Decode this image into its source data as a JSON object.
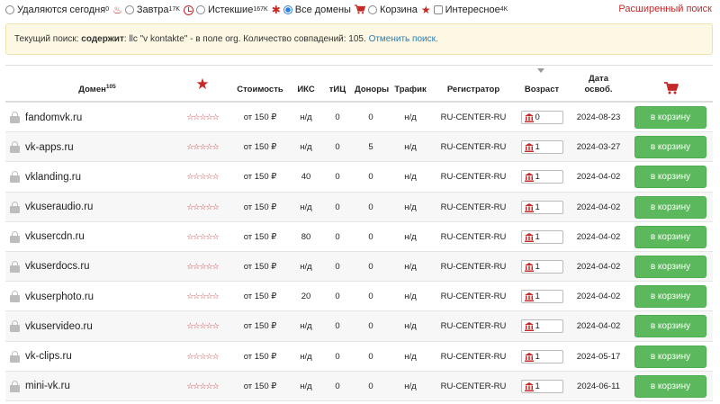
{
  "filters": [
    {
      "type": "radio",
      "checked": false,
      "icon": "",
      "label": "Удаляются сегодня",
      "sup": "0"
    },
    {
      "type": "radio",
      "checked": false,
      "icon": "fire-icon",
      "label": "Завтра",
      "sup": "17K"
    },
    {
      "type": "radio",
      "checked": false,
      "icon": "clock-icon",
      "label": "Истекшие",
      "sup": "167K"
    },
    {
      "type": "radio",
      "checked": true,
      "icon": "asterisk-icon",
      "label": "Все домены",
      "sup": ""
    },
    {
      "type": "radio",
      "checked": false,
      "icon": "cart-icon",
      "label": "Корзина",
      "sup": ""
    },
    {
      "type": "check",
      "checked": false,
      "icon": "star-icon",
      "label": "Интересное",
      "sup": "4K"
    }
  ],
  "advanced_search": "Расширенный поиск",
  "banner": {
    "prefix": "Текущий поиск: ",
    "bold": "содержит",
    "text": ": llc \"v kontakte\" - в поле org. Количество совпадений: 105. ",
    "cancel_link": "Отменить поиск."
  },
  "table": {
    "headers": {
      "domain": "Домен",
      "domain_count": "105",
      "cost": "Стоимость",
      "iks": "ИКС",
      "tic": "тИЦ",
      "donors": "Доноры",
      "traffic": "Трафик",
      "registrar": "Регистратор",
      "age": "Возраст",
      "date_line1": "Дата",
      "date_line2": "освоб."
    },
    "rating_stars": "☆☆☆☆☆",
    "button_label": "в корзину",
    "rows": [
      {
        "domain": "fandomvk.ru",
        "cost": "от 150 ₽",
        "iks": "н/д",
        "tic": "0",
        "donors": "0",
        "traffic": "н/д",
        "registrar": "RU-CENTER-RU",
        "age": "0",
        "date": "2024-08-23"
      },
      {
        "domain": "vk-apps.ru",
        "cost": "от 150 ₽",
        "iks": "н/д",
        "tic": "0",
        "donors": "5",
        "traffic": "н/д",
        "registrar": "RU-CENTER-RU",
        "age": "1",
        "date": "2024-03-27"
      },
      {
        "domain": "vklanding.ru",
        "cost": "от 150 ₽",
        "iks": "40",
        "tic": "0",
        "donors": "0",
        "traffic": "н/д",
        "registrar": "RU-CENTER-RU",
        "age": "1",
        "date": "2024-04-02"
      },
      {
        "domain": "vkuseraudio.ru",
        "cost": "от 150 ₽",
        "iks": "н/д",
        "tic": "0",
        "donors": "0",
        "traffic": "н/д",
        "registrar": "RU-CENTER-RU",
        "age": "1",
        "date": "2024-04-02"
      },
      {
        "domain": "vkusercdn.ru",
        "cost": "от 150 ₽",
        "iks": "80",
        "tic": "0",
        "donors": "0",
        "traffic": "н/д",
        "registrar": "RU-CENTER-RU",
        "age": "1",
        "date": "2024-04-02"
      },
      {
        "domain": "vkuserdocs.ru",
        "cost": "от 150 ₽",
        "iks": "н/д",
        "tic": "0",
        "donors": "0",
        "traffic": "н/д",
        "registrar": "RU-CENTER-RU",
        "age": "1",
        "date": "2024-04-02"
      },
      {
        "domain": "vkuserphoto.ru",
        "cost": "от 150 ₽",
        "iks": "20",
        "tic": "0",
        "donors": "0",
        "traffic": "н/д",
        "registrar": "RU-CENTER-RU",
        "age": "1",
        "date": "2024-04-02"
      },
      {
        "domain": "vkuservideo.ru",
        "cost": "от 150 ₽",
        "iks": "н/д",
        "tic": "0",
        "donors": "0",
        "traffic": "н/д",
        "registrar": "RU-CENTER-RU",
        "age": "1",
        "date": "2024-04-02"
      },
      {
        "domain": "vk-clips.ru",
        "cost": "от 150 ₽",
        "iks": "н/д",
        "tic": "0",
        "donors": "0",
        "traffic": "н/д",
        "registrar": "RU-CENTER-RU",
        "age": "1",
        "date": "2024-05-17"
      },
      {
        "domain": "mini-vk.ru",
        "cost": "от 150 ₽",
        "iks": "н/д",
        "tic": "0",
        "donors": "0",
        "traffic": "н/д",
        "registrar": "RU-CENTER-RU",
        "age": "1",
        "date": "2024-06-11"
      }
    ]
  },
  "colors": {
    "accent": "#c62828",
    "button": "#5cb85c",
    "link": "#2a7ab0",
    "banner_bg": "#fcf8e3"
  }
}
